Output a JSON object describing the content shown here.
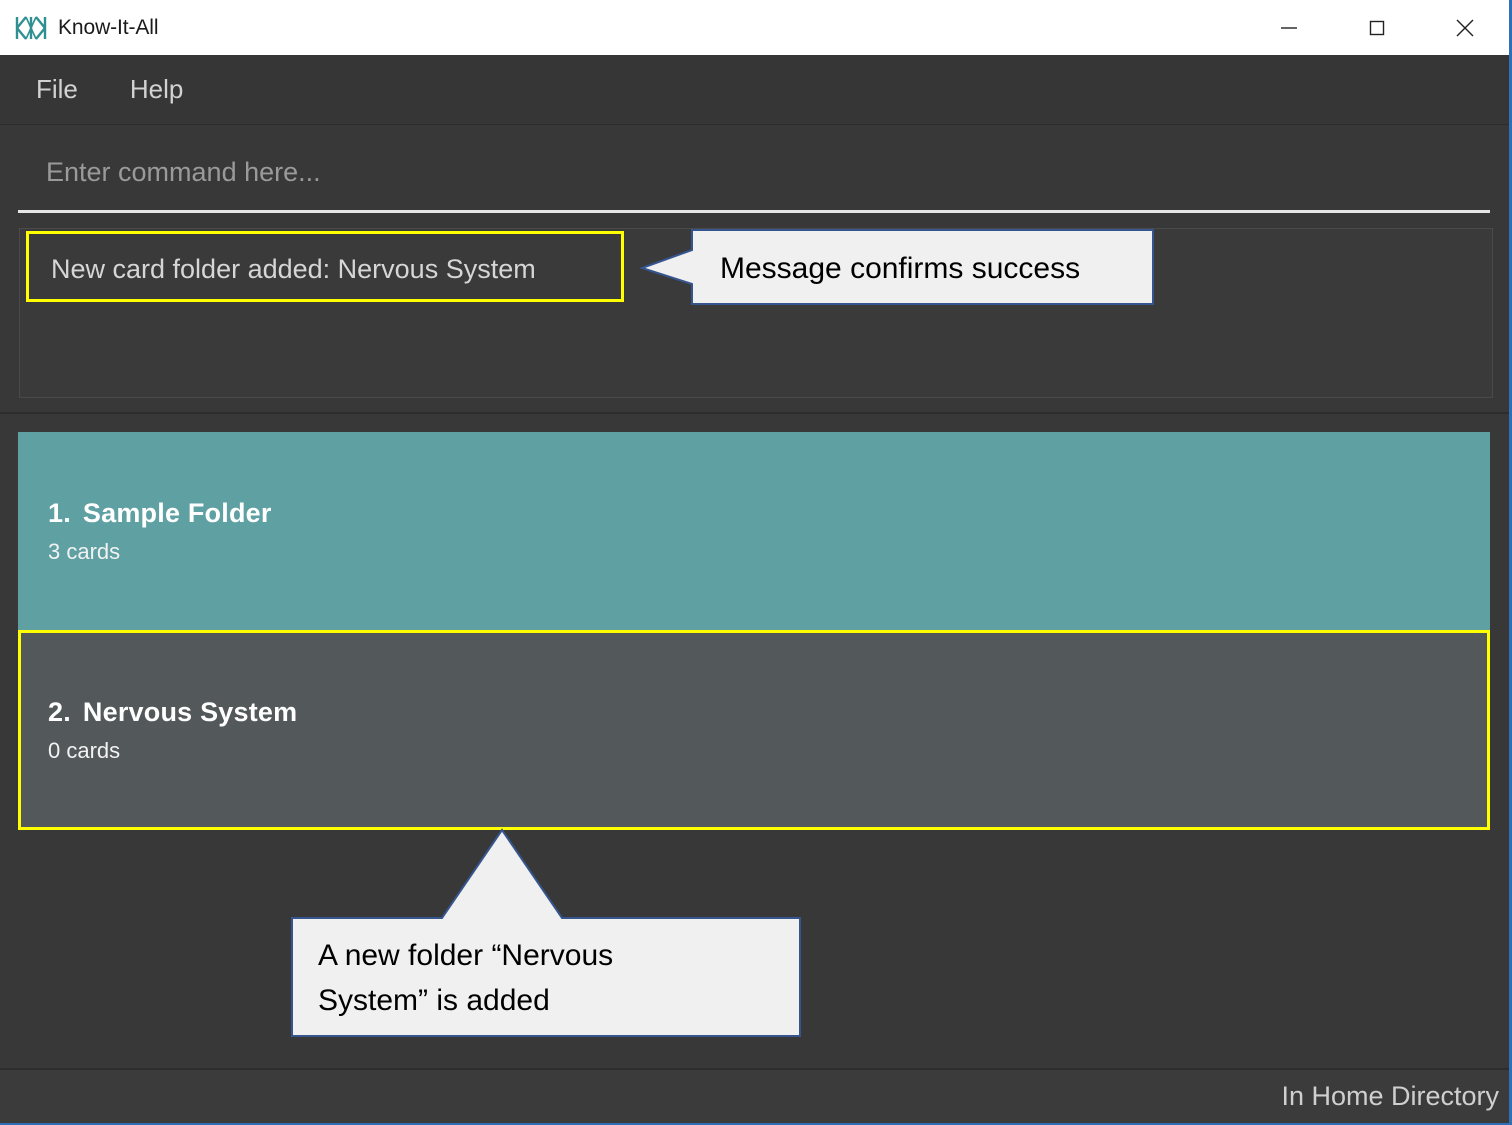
{
  "window": {
    "title": "Know-It-All",
    "logo_icon": "kia-monogram-icon",
    "controls": {
      "minimize": "minimize-icon",
      "maximize": "maximize-icon",
      "close": "close-icon"
    }
  },
  "menubar": {
    "items": [
      {
        "label": "File"
      },
      {
        "label": "Help"
      }
    ]
  },
  "command": {
    "placeholder": "Enter command here...",
    "value": ""
  },
  "output": {
    "messages": [
      "New card folder added: Nervous System"
    ]
  },
  "folders": {
    "items": [
      {
        "index": "1.",
        "name": "Sample Folder",
        "cards": "3 cards",
        "selected": true
      },
      {
        "index": "2.",
        "name": "Nervous System",
        "cards": "0 cards",
        "selected": false
      }
    ]
  },
  "status": {
    "text": "In Home Directory"
  },
  "annotations": {
    "callout_top": "Message confirms success",
    "callout_bottom_line1": "A new folder “Nervous",
    "callout_bottom_line2": "System” is added",
    "highlight_color": "#ffff00",
    "callout_fill": "#f0f0f0",
    "callout_border": "#36558f"
  },
  "colors": {
    "window_bg": "#383838",
    "titlebar_bg": "#ffffff",
    "menubar_bg": "#363636",
    "accent_teal": "#5fa0a3",
    "item_gray": "#53585b",
    "brand_teal": "#2f8f92"
  }
}
